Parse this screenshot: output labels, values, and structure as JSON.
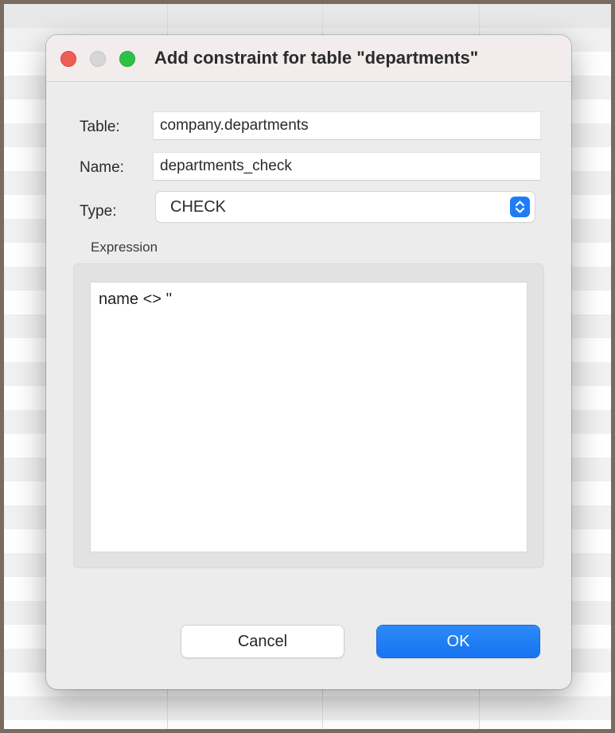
{
  "window": {
    "title": "Add constraint for table \"departments\""
  },
  "form": {
    "table_label": "Table:",
    "table_value": "company.departments",
    "name_label": "Name:",
    "name_value": "departments_check",
    "type_label": "Type:",
    "type_value": "CHECK"
  },
  "expression": {
    "section_label": "Expression",
    "value": "name <> ''"
  },
  "buttons": {
    "cancel_label": "Cancel",
    "ok_label": "OK"
  },
  "icons": {
    "close": "close-icon",
    "minimize": "minimize-icon",
    "maximize": "maximize-icon",
    "stepper": "chevron-up-down-icon"
  },
  "colors": {
    "accent": "#1f7cf5",
    "close": "#ee5e55",
    "maximize": "#2cc24a",
    "frame": "#7a6a5f"
  }
}
